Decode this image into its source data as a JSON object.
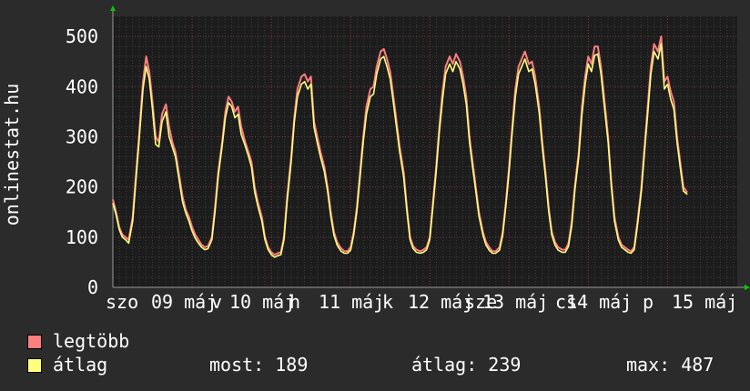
{
  "y_axis_label": "onlinestat.hu",
  "legend": {
    "max_label": "legtöbb",
    "avg_label": "átlag",
    "max_color": "#ff7f7f",
    "avg_color": "#ffff7f"
  },
  "stats": {
    "now": "most: 189",
    "average": "átlag: 239",
    "max": "max: 487"
  },
  "chart_data": {
    "type": "line",
    "title": "",
    "xlabel": "",
    "ylabel": "onlinestat.hu",
    "ylim": [
      0,
      540
    ],
    "y_ticks": [
      0,
      100,
      200,
      300,
      400,
      500
    ],
    "grid": true,
    "x_tick_labels": [
      "szo",
      "09 máj",
      "v",
      "10 máj",
      "h",
      "11 máj",
      "k",
      "12 máj",
      "sze",
      "13 máj",
      "cs",
      "14 máj",
      "p",
      "15 máj"
    ],
    "x_day_markers": [
      0,
      1,
      2,
      3,
      4,
      5,
      6,
      7
    ],
    "x": [
      0,
      0.04,
      0.08,
      0.12,
      0.16,
      0.2,
      0.25,
      0.29,
      0.33,
      0.38,
      0.42,
      0.46,
      0.5,
      0.54,
      0.58,
      0.62,
      0.67,
      0.71,
      0.75,
      0.79,
      0.83,
      0.88,
      0.92,
      0.96,
      1,
      1.04,
      1.08,
      1.12,
      1.16,
      1.2,
      1.25,
      1.29,
      1.33,
      1.38,
      1.42,
      1.46,
      1.5,
      1.54,
      1.58,
      1.62,
      1.67,
      1.71,
      1.75,
      1.79,
      1.83,
      1.88,
      1.92,
      1.96,
      2,
      2.04,
      2.08,
      2.12,
      2.16,
      2.2,
      2.25,
      2.29,
      2.33,
      2.38,
      2.42,
      2.46,
      2.5,
      2.54,
      2.58,
      2.62,
      2.67,
      2.71,
      2.75,
      2.79,
      2.83,
      2.88,
      2.92,
      2.96,
      3,
      3.04,
      3.08,
      3.12,
      3.16,
      3.2,
      3.25,
      3.29,
      3.33,
      3.38,
      3.42,
      3.46,
      3.5,
      3.54,
      3.58,
      3.62,
      3.67,
      3.71,
      3.75,
      3.79,
      3.83,
      3.88,
      3.92,
      3.96,
      4,
      4.04,
      4.08,
      4.12,
      4.16,
      4.2,
      4.25,
      4.29,
      4.33,
      4.38,
      4.42,
      4.46,
      4.5,
      4.54,
      4.58,
      4.62,
      4.67,
      4.71,
      4.75,
      4.79,
      4.83,
      4.88,
      4.92,
      4.96,
      5,
      5.04,
      5.08,
      5.12,
      5.16,
      5.2,
      5.25,
      5.29,
      5.33,
      5.38,
      5.42,
      5.46,
      5.5,
      5.54,
      5.58,
      5.62,
      5.67,
      5.71,
      5.75,
      5.79,
      5.83,
      5.88,
      5.92,
      5.96,
      6,
      6.04,
      6.08,
      6.12,
      6.16,
      6.2,
      6.25,
      6.29,
      6.33,
      6.38,
      6.42,
      6.46,
      6.5,
      6.54,
      6.58,
      6.62,
      6.67,
      6.71,
      6.75,
      6.79,
      6.83,
      6.88,
      6.92,
      6.96,
      7,
      7.04,
      7.08,
      7.12,
      7.16,
      7.2,
      7.25,
      7.29,
      7.33,
      7.38,
      7.42,
      7.46,
      7.5,
      7.54,
      7.58,
      7.62,
      7.67,
      7.71,
      7.75,
      7.79,
      7.83,
      7.88
    ],
    "series": [
      {
        "name": "legtöbb",
        "color": "#ff7f7f",
        "values": [
          175,
          150,
          120,
          105,
          100,
          95,
          140,
          220,
          300,
          410,
          460,
          430,
          370,
          300,
          290,
          345,
          365,
          320,
          290,
          270,
          230,
          180,
          155,
          140,
          120,
          105,
          95,
          85,
          80,
          82,
          100,
          160,
          230,
          290,
          350,
          380,
          370,
          350,
          360,
          320,
          290,
          270,
          250,
          200,
          170,
          140,
          100,
          80,
          70,
          65,
          68,
          70,
          100,
          180,
          260,
          340,
          395,
          420,
          425,
          410,
          420,
          330,
          300,
          270,
          240,
          200,
          150,
          110,
          90,
          78,
          72,
          72,
          80,
          110,
          160,
          230,
          300,
          360,
          395,
          400,
          440,
          470,
          475,
          455,
          430,
          380,
          330,
          280,
          230,
          160,
          100,
          82,
          75,
          72,
          75,
          80,
          100,
          170,
          240,
          320,
          390,
          440,
          460,
          445,
          465,
          450,
          420,
          380,
          300,
          250,
          200,
          150,
          110,
          90,
          80,
          72,
          72,
          80,
          110,
          170,
          240,
          320,
          395,
          440,
          455,
          470,
          445,
          450,
          420,
          360,
          290,
          230,
          160,
          110,
          90,
          80,
          75,
          75,
          88,
          130,
          200,
          270,
          360,
          420,
          460,
          445,
          480,
          480,
          440,
          380,
          300,
          210,
          140,
          100,
          85,
          80,
          75,
          72,
          80,
          130,
          200,
          280,
          360,
          440,
          485,
          470,
          500,
          410,
          420,
          390,
          370,
          300,
          250,
          200,
          189
        ]
      },
      {
        "name": "átlag",
        "color": "#ffff7f",
        "values": [
          168,
          145,
          115,
          100,
          95,
          88,
          132,
          210,
          290,
          395,
          440,
          415,
          355,
          285,
          280,
          330,
          350,
          300,
          280,
          260,
          220,
          170,
          148,
          132,
          112,
          98,
          88,
          80,
          75,
          77,
          95,
          152,
          222,
          282,
          338,
          368,
          360,
          338,
          345,
          305,
          282,
          262,
          240,
          190,
          162,
          132,
          95,
          75,
          65,
          60,
          63,
          65,
          95,
          172,
          250,
          330,
          380,
          405,
          410,
          395,
          405,
          318,
          288,
          260,
          230,
          192,
          142,
          104,
          84,
          72,
          68,
          68,
          74,
          104,
          152,
          220,
          290,
          345,
          380,
          385,
          425,
          455,
          460,
          440,
          415,
          368,
          318,
          270,
          220,
          152,
          95,
          77,
          70,
          68,
          70,
          75,
          95,
          162,
          230,
          310,
          375,
          425,
          445,
          430,
          450,
          435,
          405,
          365,
          290,
          240,
          192,
          142,
          104,
          84,
          74,
          68,
          68,
          74,
          104,
          162,
          230,
          310,
          380,
          425,
          440,
          455,
          430,
          435,
          405,
          348,
          280,
          220,
          152,
          104,
          84,
          74,
          70,
          70,
          82,
          122,
          192,
          260,
          345,
          405,
          445,
          430,
          462,
          465,
          425,
          365,
          290,
          202,
          132,
          94,
          80,
          75,
          70,
          68,
          75,
          122,
          192,
          270,
          345,
          425,
          470,
          455,
          485,
          395,
          405,
          375,
          355,
          290,
          240,
          192,
          185
        ]
      }
    ]
  }
}
